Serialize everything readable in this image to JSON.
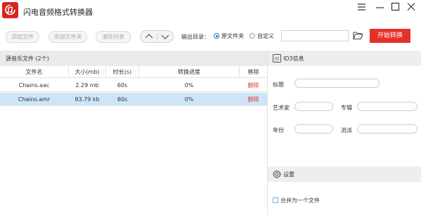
{
  "window": {
    "title": "闪电音频格式转换器",
    "controls": [
      "menu-icon",
      "minimize-icon",
      "maximize-icon",
      "close-icon"
    ]
  },
  "toolbar": {
    "add_file": "添加文件",
    "add_folder": "添加文件夹",
    "clear_list": "清除列表",
    "output_label": "输出目录：",
    "opt_source_folder": "原文件夹",
    "opt_custom": "自定义",
    "output_path": "",
    "start_convert": "开始转换"
  },
  "file_list": {
    "header": "源音乐文件 (2个)",
    "columns": [
      "文件名",
      "大小(mb)",
      "时长(s)",
      "转换进度",
      "移除"
    ],
    "rows": [
      {
        "name": "Chains.aac",
        "size": "2.29 mb",
        "duration": "60s",
        "progress": "0%",
        "remove": "删除",
        "selected": false
      },
      {
        "name": "Chains.amr",
        "size": "93.79 kb",
        "duration": "60s",
        "progress": "0%",
        "remove": "删除",
        "selected": true
      }
    ]
  },
  "id3": {
    "header": "ID3信息",
    "title_label": "标题",
    "artist_label": "艺术家",
    "album_label": "专辑",
    "year_label": "年份",
    "genre_label": "流派",
    "title_value": "",
    "artist_value": "",
    "album_value": "",
    "year_value": "",
    "genre_value": ""
  },
  "settings": {
    "header": "设置",
    "merge_label": "合并为一个文件",
    "merge_checked": false
  },
  "colors": {
    "accent": "#e4312a",
    "selected_row": "#cde6f7",
    "radio": "#1e7ad6"
  }
}
